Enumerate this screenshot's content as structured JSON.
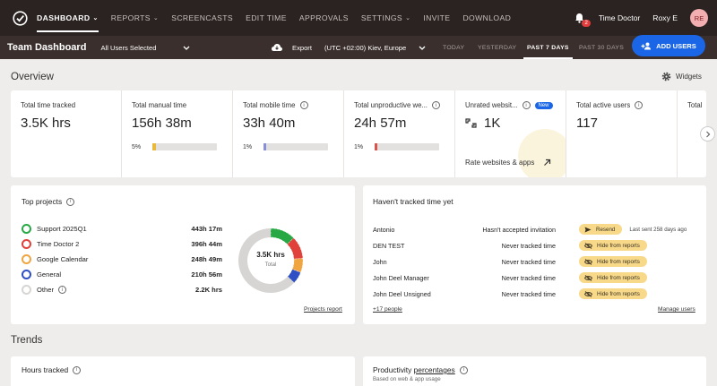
{
  "nav": {
    "items": [
      {
        "label": "DASHBOARD",
        "caret": true,
        "active": true
      },
      {
        "label": "REPORTS",
        "caret": true
      },
      {
        "label": "SCREENCASTS"
      },
      {
        "label": "EDIT TIME"
      },
      {
        "label": "APPROVALS"
      },
      {
        "label": "SETTINGS",
        "caret": true
      },
      {
        "label": "INVITE"
      },
      {
        "label": "DOWNLOAD"
      }
    ],
    "notification_count": "2",
    "company": "Time Doctor",
    "user_name": "Roxy E",
    "avatar_initials": "RE"
  },
  "subheader": {
    "title": "Team Dashboard",
    "user_filter": "All Users Selected",
    "export_label": "Export",
    "timezone": "(UTC +02:00) Kiev, Europe",
    "ranges": [
      "TODAY",
      "YESTERDAY",
      "PAST 7 DAYS",
      "PAST 30 DAYS"
    ],
    "active_range": "PAST 7 DAYS",
    "add_users_label": "ADD USERS"
  },
  "overview": {
    "title": "Overview",
    "widgets_label": "Widgets",
    "metrics": [
      {
        "label": "Total time tracked",
        "value": "3.5K hrs"
      },
      {
        "label": "Total manual time",
        "value": "156h 38m",
        "percent": "5%",
        "fill": 0.05,
        "color": "#e8b93a"
      },
      {
        "label": "Total mobile time",
        "value": "33h 40m",
        "percent": "1%",
        "fill": 0.01,
        "color": "#8a8fd8"
      },
      {
        "label": "Total unproductive we...",
        "value": "24h 57m",
        "percent": "1%",
        "fill": 0.01,
        "color": "#d9534f"
      },
      {
        "label": "Unrated websit...",
        "value": "1K",
        "badge": "New",
        "link": "Rate websites & apps"
      },
      {
        "label": "Total active users",
        "value": "117"
      },
      {
        "label": "Total"
      }
    ]
  },
  "top_projects": {
    "title": "Top projects",
    "total": "3.5K hrs",
    "total_label": "Total",
    "link": "Projects report",
    "projects": [
      {
        "name": "Support 2025Q1",
        "time": "443h 17m",
        "color": "#27a844",
        "share": 0.126
      },
      {
        "name": "Time Doctor 2",
        "time": "396h 44m",
        "color": "#e0413b",
        "share": 0.113
      },
      {
        "name": "Google Calendar",
        "time": "248h 49m",
        "color": "#f0a541",
        "share": 0.071
      },
      {
        "name": "General",
        "time": "210h 56m",
        "color": "#2f4fc4",
        "share": 0.06
      },
      {
        "name": "Other",
        "time": "2.2K hrs",
        "color": "#d7d5d3",
        "share": 0.63
      }
    ]
  },
  "untracked": {
    "title": "Haven't tracked time yet",
    "rows": [
      {
        "name": "Antonio",
        "status": "Hasn't accepted invitation",
        "action": "Resend",
        "icon": "send-icon",
        "note": "Last sent 258 days ago"
      },
      {
        "name": "DEN TEST",
        "status": "Never tracked time",
        "action": "Hide from reports",
        "icon": "eye-off-icon"
      },
      {
        "name": "John",
        "status": "Never tracked time",
        "action": "Hide from reports",
        "icon": "eye-off-icon"
      },
      {
        "name": "John Deel Manager",
        "status": "Never tracked time",
        "action": "Hide from reports",
        "icon": "eye-off-icon"
      },
      {
        "name": "John Deel Unsigned",
        "status": "Never tracked time",
        "action": "Hide from reports",
        "icon": "eye-off-icon"
      }
    ],
    "more_link": "+17 people",
    "manage_link": "Manage users"
  },
  "trends": {
    "title": "Trends",
    "hours_tracked": "Hours tracked",
    "productivity_prefix": "Productivity ",
    "productivity_underlined": "percentages",
    "productivity_sub": "Based on web & app usage"
  }
}
